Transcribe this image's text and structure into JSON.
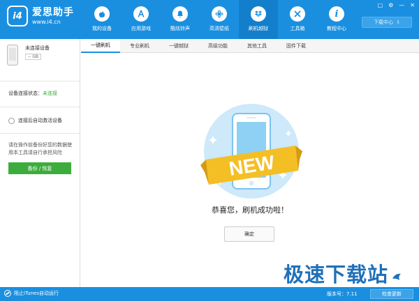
{
  "app": {
    "logo_badge": "i4",
    "name": "爱思助手",
    "url": "www.i4.cn"
  },
  "nav": [
    {
      "label": "我的设备",
      "icon": "apple-icon"
    },
    {
      "label": "应用游戏",
      "icon": "appstore-icon"
    },
    {
      "label": "酷炫铃声",
      "icon": "bell-icon"
    },
    {
      "label": "高清壁纸",
      "icon": "flower-icon"
    },
    {
      "label": "刷机越狱",
      "icon": "dropbox-icon",
      "active": true
    },
    {
      "label": "工具箱",
      "icon": "tools-icon"
    },
    {
      "label": "教程中心",
      "icon": "info-icon"
    }
  ],
  "header": {
    "download_center": "下载中心"
  },
  "sidebar": {
    "device_name": "未连接设备",
    "capacity": "-- GB",
    "status_label": "设备连接状态：",
    "status_value": "未连接",
    "auto_activate": "连接后自动激活设备",
    "warning": "请在操作前备份好您的数据使用本工具请自行承担风险",
    "backup_button": "备份 / 恢复"
  },
  "tabs": [
    {
      "label": "一键刷机",
      "active": true
    },
    {
      "label": "专业刷机"
    },
    {
      "label": "一键越狱"
    },
    {
      "label": "高级功能"
    },
    {
      "label": "其他工具"
    },
    {
      "label": "固件下载"
    }
  ],
  "main": {
    "badge_text": "NEW",
    "success_message": "恭喜您，刷机成功啦！",
    "confirm_button": "确定"
  },
  "watermark": "极速下载站",
  "footer": {
    "stop_itunes": "阻止iTunes自动运行",
    "version": "版本号：7.11",
    "check_update": "检查更新"
  },
  "colors": {
    "primary": "#1a8fe0",
    "success_green": "#3cad3c"
  }
}
